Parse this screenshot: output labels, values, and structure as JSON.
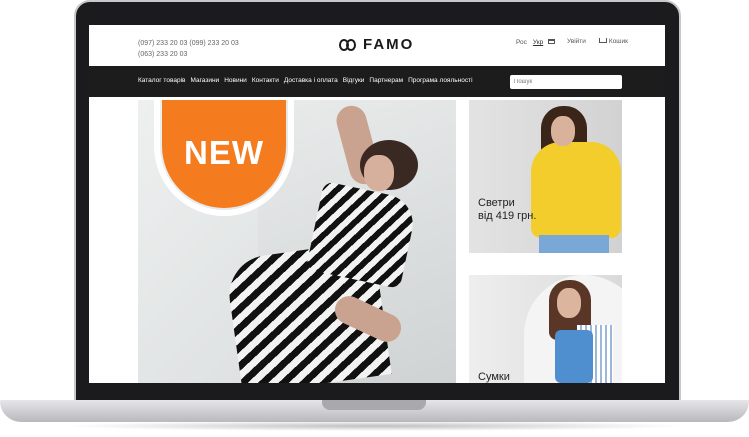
{
  "header": {
    "phones": [
      "(097) 233 20 03  (099) 233 20 03",
      "(063) 233 20 03"
    ],
    "logo": "FAMO",
    "languages": [
      {
        "label": "Рос",
        "active": false
      },
      {
        "label": "Укр",
        "active": true
      }
    ],
    "login_label": "Увійти",
    "cart_label": "Кошик"
  },
  "nav": {
    "items": [
      "Каталог товарів",
      "Магазини",
      "Новини",
      "Контакти",
      "Доставка і оплата",
      "Відгуки",
      "Партнерам",
      "Програма лояльності"
    ],
    "search_placeholder": "Пошук"
  },
  "hero": {
    "badge_text": "NEW",
    "badge_color": "#f47b1e"
  },
  "promos": [
    {
      "label_line1": "Светри",
      "label_line2": "від 419 грн."
    },
    {
      "label_line1": "Сумки"
    }
  ],
  "icons": [
    "logo-icon",
    "card-icon",
    "cart-icon"
  ]
}
